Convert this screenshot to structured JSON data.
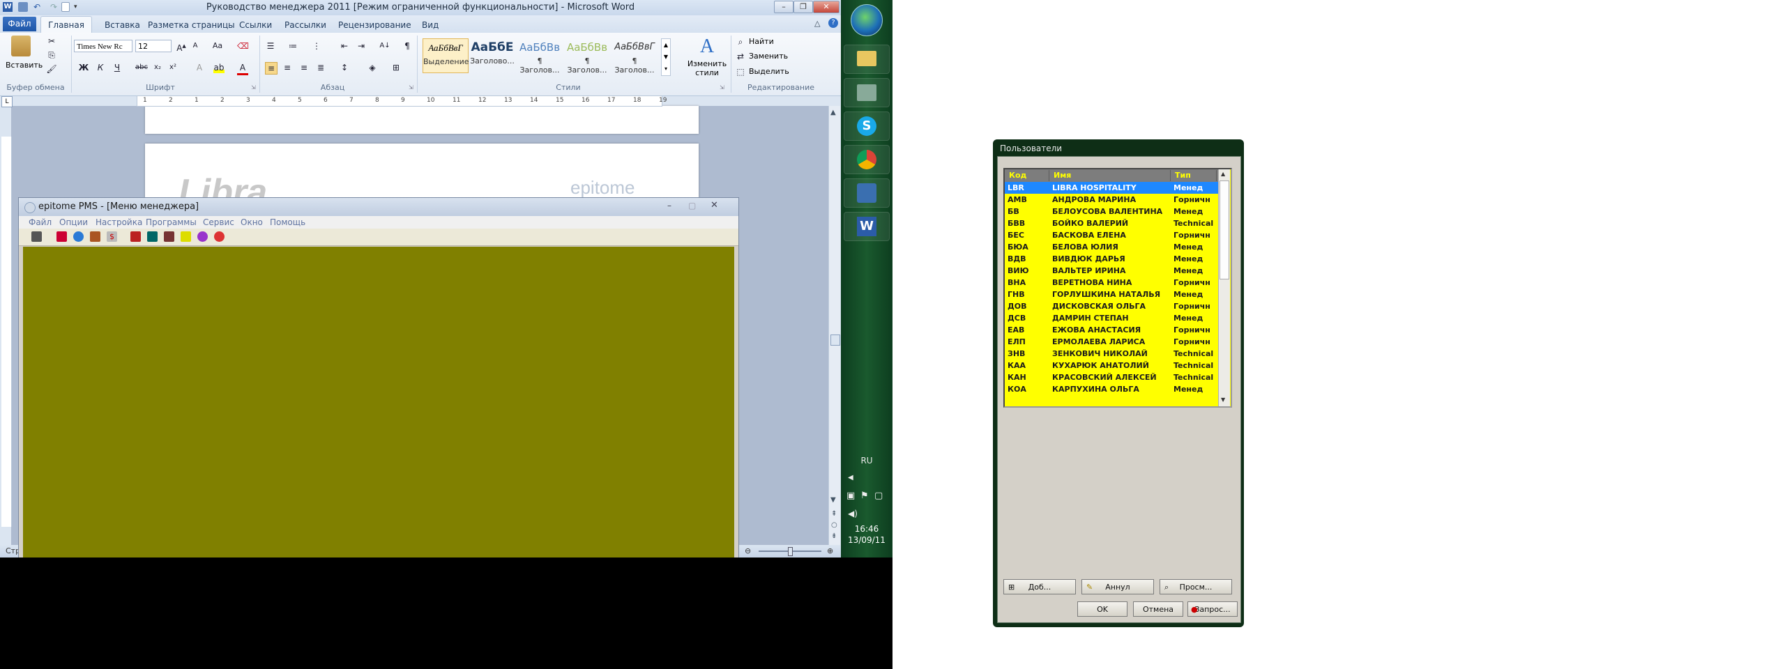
{
  "word": {
    "title": "Руководство менеджера 2011 [Режим ограниченной функциональности] - Microsoft Word",
    "tabs": [
      "Файл",
      "Главная",
      "Вставка",
      "Разметка страницы",
      "Ссылки",
      "Рассылки",
      "Рецензирование",
      "Вид"
    ],
    "clipboard": {
      "paste_label": "Вставить",
      "group_label": "Буфер обмена"
    },
    "font": {
      "name": "Times New Rc",
      "size": "12",
      "group_label": "Шрифт"
    },
    "paragraph": {
      "group_label": "Абзац"
    },
    "styles": {
      "group_label": "Стили",
      "items": [
        {
          "preview": "АаБбВвГ",
          "label": "Выделение"
        },
        {
          "preview": "АаБбЕ",
          "label": "Заголово..."
        },
        {
          "preview": "АаБбВв",
          "label": "¶ Заголов..."
        },
        {
          "preview": "АаБбВв",
          "label": "¶ Заголов..."
        },
        {
          "preview": "АаБбВвГ",
          "label": "¶ Заголов..."
        }
      ],
      "change_label": "Изменить стили"
    },
    "editing": {
      "find": "Найти",
      "replace": "Заменить",
      "select": "Выделить",
      "group_label": "Редактирование"
    },
    "ruler_numbers": [
      "1",
      "2",
      "1",
      "2",
      "3",
      "4",
      "5",
      "6",
      "7",
      "8",
      "9",
      "10",
      "11",
      "12",
      "13",
      "14",
      "15",
      "16",
      "17",
      "18",
      "19"
    ],
    "doc_logo_left": "Libra",
    "doc_logo_right": "epitome",
    "statusbar_left": "Стр"
  },
  "pms": {
    "title": "epitome PMS - [Меню менеджера]",
    "menu": [
      "Файл",
      "Опции",
      "Настройка",
      "Программы",
      "Сервис",
      "Окно",
      "Помощь"
    ],
    "bg_color": "#808000"
  },
  "taskbar": {
    "lang": "RU",
    "time": "16:46",
    "date": "13/09/11",
    "apps": [
      "explorer-icon",
      "tools-icon",
      "skype-icon",
      "chrome-icon",
      "pms-icon",
      "word-icon"
    ]
  },
  "users": {
    "title": "Пользователи",
    "columns": [
      "Код",
      "Имя",
      "Тип"
    ],
    "rows": [
      {
        "code": "LBR",
        "name": "LIBRA HOSPITALITY",
        "type": "Менед",
        "selected": true
      },
      {
        "code": "АМВ",
        "name": "АНДРОВА МАРИНА",
        "type": "Горничн"
      },
      {
        "code": "БВ",
        "name": "БЕЛОУСОВА ВАЛЕНТИНА",
        "type": "Менед"
      },
      {
        "code": "БВВ",
        "name": "БОЙКО ВАЛЕРИЙ",
        "type": "Technical"
      },
      {
        "code": "БЕС",
        "name": "БАСКОВА ЕЛЕНА",
        "type": "Горничн"
      },
      {
        "code": "БЮА",
        "name": "БЕЛОВА ЮЛИЯ",
        "type": "Менед"
      },
      {
        "code": "ВДВ",
        "name": "ВИВДЮК ДАРЬЯ",
        "type": "Менед"
      },
      {
        "code": "ВИЮ",
        "name": "ВАЛЬТЕР ИРИНА",
        "type": "Менед"
      },
      {
        "code": "ВНА",
        "name": "ВЕРЕТНОВА НИНА",
        "type": "Горничн"
      },
      {
        "code": "ГНВ",
        "name": "ГОРЛУШКИНА НАТАЛЬЯ",
        "type": "Менед"
      },
      {
        "code": "ДОВ",
        "name": "ДИСКОВСКАЯ ОЛЬГА",
        "type": "Горничн"
      },
      {
        "code": "ДСВ",
        "name": "ДАМРИН СТЕПАН",
        "type": "Менед"
      },
      {
        "code": "ЕАВ",
        "name": "ЕЖОВА АНАСТАСИЯ",
        "type": "Горничн"
      },
      {
        "code": "ЕЛП",
        "name": "ЕРМОЛАЕВА ЛАРИСА",
        "type": "Горничн"
      },
      {
        "code": "ЗНВ",
        "name": "ЗЕНКОВИЧ НИКОЛАЙ",
        "type": "Technical"
      },
      {
        "code": "КАА",
        "name": "КУХАРЮК АНАТОЛИЙ",
        "type": "Technical"
      },
      {
        "code": "КАН",
        "name": "КРАСОВСКИЙ АЛЕКСЕЙ",
        "type": "Technical"
      },
      {
        "code": "КОА",
        "name": "КАРПУХИНА ОЛЬГА",
        "type": "Менед"
      }
    ],
    "buttons": {
      "add": "Доб...",
      "cancel_row": "Аннул",
      "view": "Просм...",
      "ok": "OK",
      "cancel": "Отмена",
      "query": "Запрос..."
    }
  }
}
